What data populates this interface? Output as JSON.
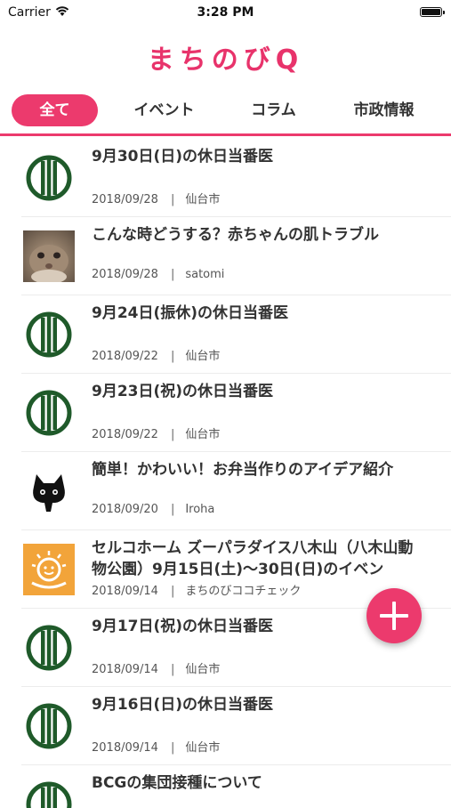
{
  "status_bar": {
    "carrier": "Carrier",
    "time": "3:28 PM",
    "battery_level": 0.95
  },
  "app": {
    "logo_text": "まちのびQ"
  },
  "tabs": [
    {
      "label": "全て",
      "active": true
    },
    {
      "label": "イベント",
      "active": false
    },
    {
      "label": "コラム",
      "active": false
    },
    {
      "label": "市政情報",
      "active": false
    }
  ],
  "articles": [
    {
      "title": "9月30日(日)の休日当番医",
      "date": "2018/09/28",
      "author": "仙台市",
      "thumb": "sendai-city-emblem"
    },
    {
      "title": "こんな時どうする？赤ちゃんの肌トラブル",
      "date": "2018/09/28",
      "author": "satomi",
      "thumb": "rabbit-photo"
    },
    {
      "title": "9月24日(振休)の休日当番医",
      "date": "2018/09/22",
      "author": "仙台市",
      "thumb": "sendai-city-emblem"
    },
    {
      "title": "9月23日(祝)の休日当番医",
      "date": "2018/09/22",
      "author": "仙台市",
      "thumb": "sendai-city-emblem"
    },
    {
      "title": "簡単！かわいい！お弁当作りのアイデア紹介",
      "date": "2018/09/20",
      "author": "Iroha",
      "thumb": "black-cat-icon"
    },
    {
      "title": "セルコホーム ズーパラダイス八木山（八木山動物公園）9月15日(土)〜30日(日)のイベン",
      "date": "2018/09/14",
      "author": "まちのびココチェック",
      "thumb": "sun-smile-logo"
    },
    {
      "title": "9月17日(祝)の休日当番医",
      "date": "2018/09/14",
      "author": "仙台市",
      "thumb": "sendai-city-emblem"
    },
    {
      "title": "9月16日(日)の休日当番医",
      "date": "2018/09/14",
      "author": "仙台市",
      "thumb": "sendai-city-emblem"
    },
    {
      "title": "BCGの集団接種について",
      "date": "",
      "author": "",
      "thumb": "sendai-city-emblem"
    }
  ],
  "meta_separator": "|",
  "colors": {
    "accent": "#ec3a6d",
    "emblem": "#1f5a2a"
  }
}
